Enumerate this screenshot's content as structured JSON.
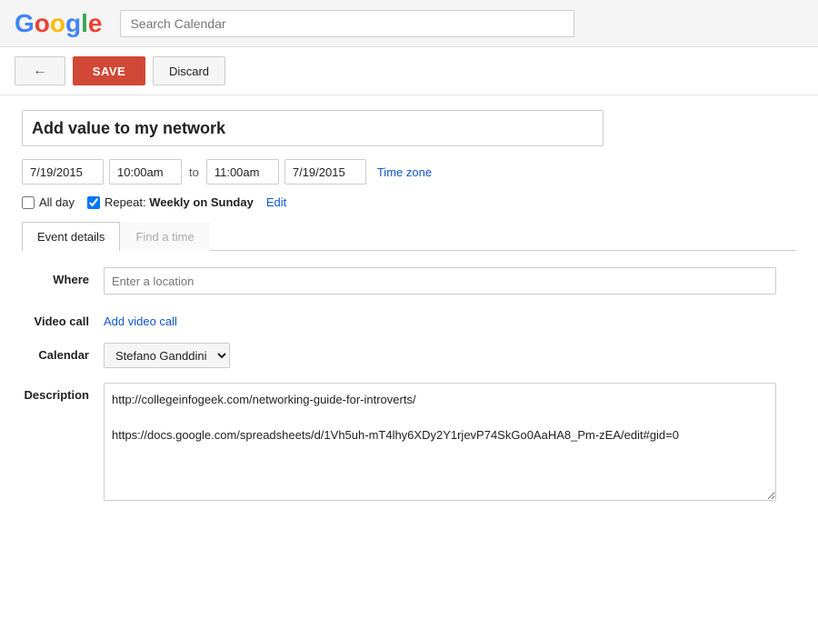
{
  "header": {
    "search_placeholder": "Search Calendar"
  },
  "toolbar": {
    "back_icon": "←",
    "save_label": "SAVE",
    "discard_label": "Discard"
  },
  "event": {
    "title": "Add value to my network",
    "start_date": "7/19/2015",
    "start_time": "10:00am",
    "to_label": "to",
    "end_time": "11:00am",
    "end_date": "7/19/2015",
    "timezone_label": "Time zone",
    "allday_label": "All day",
    "allday_checked": false,
    "repeat_checked": true,
    "repeat_label": "Repeat:",
    "repeat_value": "Weekly on Sunday",
    "repeat_edit_label": "Edit"
  },
  "tabs": [
    {
      "label": "Event details",
      "active": true
    },
    {
      "label": "Find a time",
      "active": false
    }
  ],
  "form": {
    "where_label": "Where",
    "where_placeholder": "Enter a location",
    "videocall_label": "Video call",
    "videocall_link": "Add video call",
    "calendar_label": "Calendar",
    "calendar_value": "Stefano Ganddini",
    "calendar_options": [
      "Stefano Ganddini"
    ],
    "description_label": "Description",
    "description_value": "http://collegeinfogeek.com/networking-guide-for-introverts/\n\nhttps://docs.google.com/spreadsheets/d/1Vh5uh-mT4lhy6XDy2Y1rjevP74SkGo0AaHA8_Pm-zEA/edit#gid=0"
  },
  "colors": {
    "save_bg": "#d14836",
    "link_color": "#1155CC"
  }
}
